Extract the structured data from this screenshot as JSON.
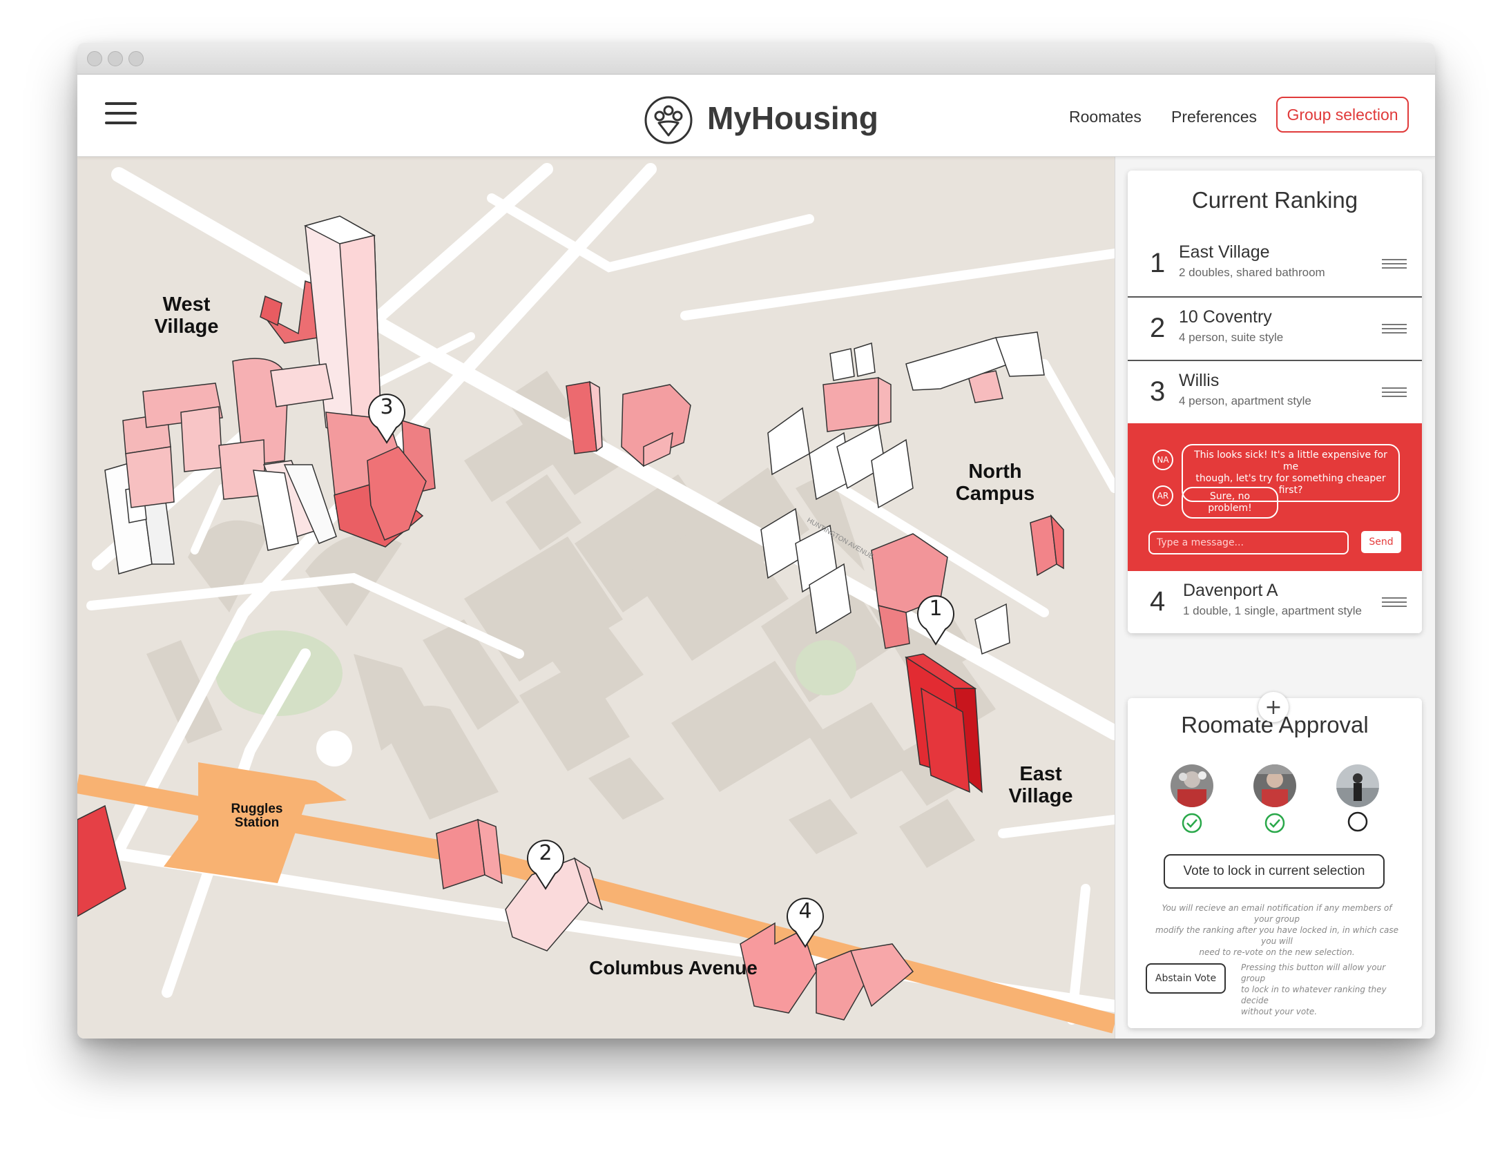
{
  "header": {
    "app_name": "MyHousing",
    "nav": [
      {
        "label": "Roomates"
      },
      {
        "label": "Preferences"
      }
    ],
    "group_selection_label": "Group selection"
  },
  "map": {
    "area_labels": [
      {
        "line1": "West",
        "line2": "Village"
      },
      {
        "line1": "North",
        "line2": "Campus"
      },
      {
        "line1": "East",
        "line2": "Village"
      }
    ],
    "station_line1": "Ruggles",
    "station_line2": "Station",
    "street_label": "Columbus Avenue",
    "small_street_label": "HUNTINGTON AVENUE",
    "pins": [
      "1",
      "2",
      "3",
      "4"
    ]
  },
  "ranking": {
    "title": "Current Ranking",
    "items": [
      {
        "rank": "1",
        "name": "East Village",
        "desc": "2 doubles, shared bathroom"
      },
      {
        "rank": "2",
        "name": "10 Coventry",
        "desc": "4 person, suite style"
      },
      {
        "rank": "3",
        "name": "Willis",
        "desc": "4 person, apartment style"
      },
      {
        "rank": "4",
        "name": "Davenport A",
        "desc": "1 double, 1 single, apartment style"
      }
    ],
    "chat": {
      "messages": [
        {
          "initials": "NA",
          "text_line1": "This looks sick! It's a little expensive for me",
          "text_line2": "though, let's try for something cheaper first?"
        },
        {
          "initials": "AR",
          "text_line1": "Sure, no problem!"
        }
      ],
      "input_placeholder": "Type a message...",
      "send_label": "Send"
    },
    "add_label": "+"
  },
  "approval": {
    "title": "Roomate Approval",
    "roommates": [
      {
        "status": "approved"
      },
      {
        "status": "approved"
      },
      {
        "status": "pending"
      }
    ],
    "vote_label": "Vote to lock in current selection",
    "vote_note_lines": [
      "You will recieve an email notification if any members of your group",
      "modify the ranking after you have locked in, in which case you will",
      "need to re-vote on the new selection."
    ],
    "abstain_label": "Abstain Vote",
    "abstain_note_lines": [
      "Pressing this button will allow your group",
      "to lock in to whatever ranking they decide",
      "without your vote."
    ]
  },
  "colors": {
    "accent": "#e43a3a",
    "approved": "#2aa84a",
    "map_bg": "#e8e3dc",
    "building_light": "#f6a3a5",
    "building_dark": "#e2363b",
    "station": "#f8b272",
    "park": "#d4e0c6"
  }
}
